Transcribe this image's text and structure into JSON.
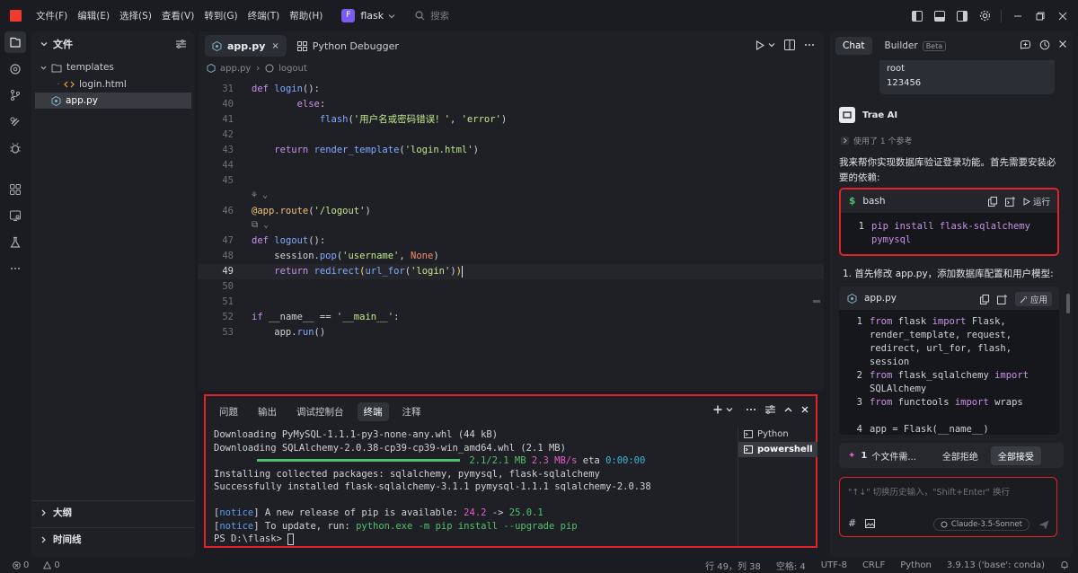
{
  "menu": [
    "文件(F)",
    "编辑(E)",
    "选择(S)",
    "查看(V)",
    "转到(G)",
    "终端(T)",
    "帮助(H)"
  ],
  "project": {
    "badge": "F",
    "name": "flask"
  },
  "search": {
    "placeholder": "搜索"
  },
  "sidebar": {
    "title": "文件",
    "tree": [
      {
        "label": "templates",
        "kind": "folder"
      },
      {
        "label": "login.html",
        "kind": "html"
      },
      {
        "label": "app.py",
        "kind": "python",
        "selected": true
      }
    ],
    "sections": [
      "大纲",
      "时间线"
    ]
  },
  "editor": {
    "tabs": [
      {
        "label": "app.py",
        "active": true,
        "close": "×"
      },
      {
        "label": "Python Debugger",
        "active": false
      }
    ],
    "breadcrumb": [
      "app.py",
      "logout"
    ],
    "lines": [
      {
        "n": "31",
        "code": "def login():"
      },
      {
        "n": "40",
        "code": "        else:"
      },
      {
        "n": "41",
        "code": "            flash('用户名或密码错误！', 'error')"
      },
      {
        "n": "42",
        "code": ""
      },
      {
        "n": "43",
        "code": "    return render_template('login.html')"
      },
      {
        "n": "44",
        "code": ""
      },
      {
        "n": "45",
        "code": ""
      },
      {
        "n": "46",
        "code": "@app.route('/logout')"
      },
      {
        "n": "47",
        "code": "def logout():"
      },
      {
        "n": "48",
        "code": "    session.pop('username', None)"
      },
      {
        "n": "49",
        "code": "    return redirect(url_for('login'))"
      },
      {
        "n": "50",
        "code": ""
      },
      {
        "n": "51",
        "code": ""
      },
      {
        "n": "52",
        "code": "if __name__ == '__main__':"
      },
      {
        "n": "53",
        "code": "    app.run()"
      }
    ],
    "current_line": "49"
  },
  "panel": {
    "tabs": [
      "问题",
      "输出",
      "调试控制台",
      "终端",
      "注释"
    ],
    "active_tab": "终端",
    "terminal": {
      "l1": "Downloading PyMySQL-1.1.1-py3-none-any.whl (44 kB)",
      "l2": "Downloading SQLAlchemy-2.0.38-cp39-cp39-win_amd64.whl (2.1 MB)",
      "progress_size": "2.1/2.1 MB",
      "progress_speed": "2.3 MB/s",
      "progress_eta_label": "eta",
      "progress_eta": "0:00:00",
      "progress_fraction": 1.0,
      "l4": "Installing collected packages: sqlalchemy, pymysql, flask-sqlalchemy",
      "l5": "Successfully installed flask-sqlalchemy-3.1.1 pymysql-1.1.1 sqlalchemy-2.0.38",
      "notice": "notice",
      "n1_text": " A new release of pip is available: ",
      "n1_old": "24.2",
      "n1_arrow": " -> ",
      "n1_new": "25.0.1",
      "n2_text": " To update, run: ",
      "n2_cmd": "python.exe -m pip install --upgrade pip",
      "prompt": "PS D:\\flask> "
    },
    "terminals": [
      {
        "label": "Python",
        "selected": false
      },
      {
        "label": "powershell",
        "selected": true
      }
    ]
  },
  "chat": {
    "tabs": [
      {
        "label": "Chat",
        "active": true
      },
      {
        "label": "Builder",
        "active": false
      }
    ],
    "beta": "Beta",
    "user_lines": [
      "root",
      "123456"
    ],
    "assistant_name": "Trae AI",
    "refs": "使用了 1 个参考",
    "intro": "我来帮你实现数据库验证登录功能。首先需要安装必要的依赖:",
    "bash_card": {
      "lang": "bash",
      "run_label": "运行",
      "lines": [
        {
          "n": "1",
          "text": "pip install flask-sqlalchemy"
        },
        {
          "n": "",
          "text": "pymysql"
        }
      ]
    },
    "step1": "1. 首先修改 app.py，添加数据库配置和用户模型:",
    "app_card": {
      "file": "app.py",
      "apply_label": "应用",
      "lines": [
        {
          "n": "1",
          "kw": "from",
          "text": " flask ",
          "kw2": "import",
          "rest": " Flask,"
        },
        {
          "n": "",
          "kw": "",
          "text": "render_template, request,",
          "kw2": "",
          "rest": ""
        },
        {
          "n": "",
          "kw": "",
          "text": "redirect, url_for, flash,",
          "kw2": "",
          "rest": ""
        },
        {
          "n": "",
          "kw": "",
          "text": "session",
          "kw2": "",
          "rest": ""
        },
        {
          "n": "2",
          "kw": "from",
          "text": " flask_sqlalchemy ",
          "kw2": "import",
          "rest": ""
        },
        {
          "n": "",
          "kw": "",
          "text": "SQLAlchemy",
          "kw2": "",
          "rest": ""
        },
        {
          "n": "3",
          "kw": "from",
          "text": " functools ",
          "kw2": "import",
          "rest": " wraps"
        },
        {
          "n": "",
          "kw": "",
          "text": "",
          "kw2": "",
          "rest": ""
        },
        {
          "n": "4",
          "kw": "",
          "text": "app = Flask(__name__)",
          "kw2": "",
          "rest": ""
        }
      ]
    },
    "review": {
      "count": "1",
      "label": "个文件需...",
      "reject": "全部拒绝",
      "accept": "全部接受"
    },
    "input": {
      "placeholder": "\"↑↓\" 切换历史输入，\"Shift+Enter\" 换行",
      "model": "Claude-3.5-Sonnet",
      "hash": "#"
    }
  },
  "status": {
    "errors": "0",
    "warnings": "0",
    "position": "行 49，列 38",
    "spaces": "空格: 4",
    "encoding": "UTF-8",
    "eol": "CRLF",
    "language": "Python",
    "interpreter": "3.9.13 ('base': conda)"
  },
  "colors": {
    "accent_red": "#e0232b",
    "project_badge": "#7b5cf0",
    "logo": "#ef3b2c"
  }
}
